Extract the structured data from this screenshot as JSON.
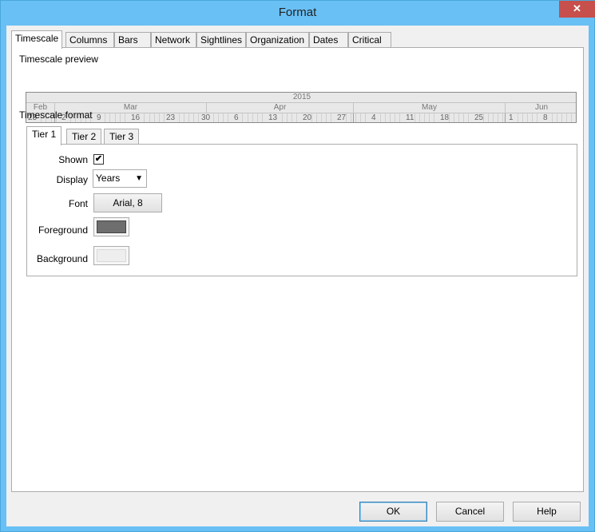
{
  "window": {
    "title": "Format",
    "close_glyph": "✕"
  },
  "tabs": [
    "Timescale",
    "Columns",
    "Bars",
    "Network",
    "Sightlines",
    "Organization",
    "Dates",
    "Critical"
  ],
  "timescale": {
    "preview_label": "Timescale preview",
    "format_label": "Timescale format",
    "year": "2015",
    "months": [
      "Feb",
      "Mar",
      "Apr",
      "May",
      "Jun"
    ],
    "days": [
      "23",
      "2",
      "9",
      "16",
      "23",
      "30",
      "6",
      "13",
      "20",
      "27",
      "4",
      "11",
      "18",
      "25",
      "1",
      "8"
    ]
  },
  "tiers": [
    "Tier 1",
    "Tier 2",
    "Tier 3"
  ],
  "tier_form": {
    "shown_label": "Shown",
    "shown_checked": true,
    "check_glyph": "✔",
    "display_label": "Display",
    "display_value": "Years",
    "font_label": "Font",
    "font_value": "Arial, 8",
    "foreground_label": "Foreground",
    "foreground_color": "#6e6e6e",
    "background_label": "Background",
    "background_color": "#eeeeee"
  },
  "buttons": {
    "ok": "OK",
    "cancel": "Cancel",
    "help": "Help"
  }
}
